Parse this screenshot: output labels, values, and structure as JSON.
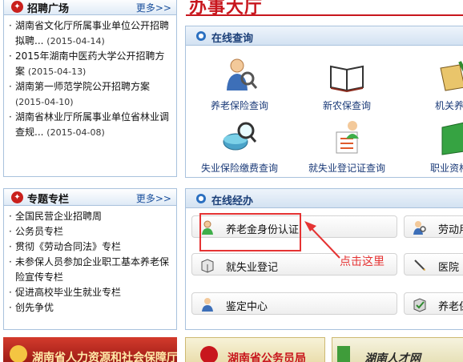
{
  "page": {
    "header_title": "办事大厅"
  },
  "left": {
    "recruit": {
      "title": "招聘广场",
      "more": "更多>>",
      "items": [
        {
          "text": "湖南省文化厅所属事业单位公开招聘拟聘...",
          "date": "(2015-04-14)"
        },
        {
          "text": "2015年湖南中医药大学公开招聘方案",
          "date": "(2015-04-13)"
        },
        {
          "text": "湖南第一师范学院公开招聘方案",
          "date": "(2015-04-10)"
        },
        {
          "text": "湖南省林业厅所属事业单位省林业调查规...",
          "date": "(2015-04-08)"
        }
      ]
    },
    "special": {
      "title": "专题专栏",
      "more": "更多>>",
      "items": [
        "全国民营企业招聘周",
        "公务员专栏",
        "贯彻《劳动合同法》专栏",
        "未参保人员参加企业职工基本养老保险宣传专栏",
        "促进高校毕业生就业专栏",
        "创先争优"
      ]
    }
  },
  "online_query": {
    "title": "在线查询",
    "items": [
      {
        "label": "养老保险查询",
        "icon": "person-magnifier-icon"
      },
      {
        "label": "新农保查询",
        "icon": "open-book-icon"
      },
      {
        "label": "机关养老",
        "icon": "pen-book-icon"
      },
      {
        "label": "失业保险缴费查询",
        "icon": "world-magnifier-icon"
      },
      {
        "label": "就失业登记证查询",
        "icon": "person-checklist-icon"
      },
      {
        "label": "职业资格证",
        "icon": "green-book-icon"
      }
    ]
  },
  "online_service": {
    "title": "在线经办",
    "buttons": [
      {
        "label": "养老金身份认证",
        "icon": "person-icon"
      },
      {
        "label": "劳动用",
        "icon": "person-search-icon"
      },
      {
        "label": "就失业登记",
        "icon": "box-icon"
      },
      {
        "label": "医院",
        "icon": "pen-icon"
      },
      {
        "label": "鉴定中心",
        "icon": "person-badge-icon"
      },
      {
        "label": "养老保",
        "icon": "box-check-icon"
      }
    ]
  },
  "annotation": {
    "text": "点击这里"
  },
  "banners": [
    {
      "text": "湖南省人力资源和社会保障厅"
    },
    {
      "text": "湖南省公务员局"
    },
    {
      "text": "湖南人才网"
    }
  ],
  "colors": {
    "accent_red": "#c8161d",
    "link_blue": "#1a3a78",
    "border_blue": "#a9c2dd",
    "annotation_red": "#e53333"
  }
}
